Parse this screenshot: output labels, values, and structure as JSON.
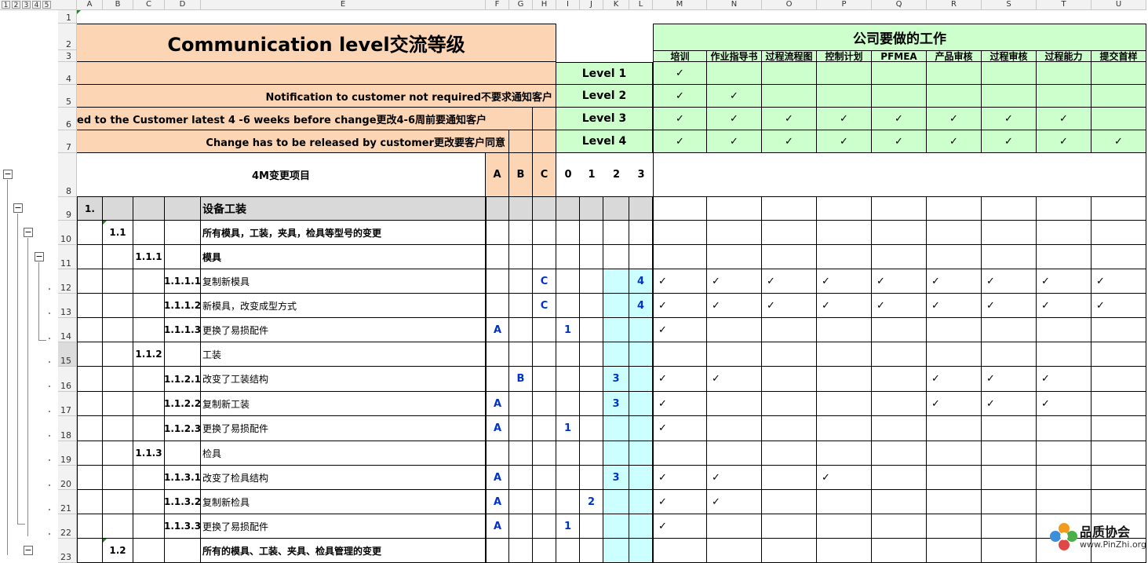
{
  "outline_levels": [
    "1",
    "2",
    "3",
    "4",
    "5"
  ],
  "columns": [
    "A",
    "B",
    "C",
    "D",
    "E",
    "F",
    "G",
    "H",
    "I",
    "J",
    "K",
    "L",
    "M",
    "N",
    "O",
    "P",
    "Q",
    "R",
    "S",
    "T",
    "U"
  ],
  "rows": [
    "1",
    "2",
    "3",
    "4",
    "5",
    "6",
    "7",
    "8",
    "9",
    "10",
    "11",
    "12",
    "13",
    "14",
    "15",
    "16",
    "17",
    "18",
    "19",
    "20",
    "21",
    "22",
    "23"
  ],
  "selected_row": "15",
  "title": "Communication level交流等级",
  "company_header": "公司要做的工作",
  "tasks": [
    "培训",
    "作业指导书",
    "过程流程图",
    "控制计划",
    "PFMEA",
    "产品审核",
    "过程审核",
    "过程能力",
    "提交首样"
  ],
  "notices": {
    "row5": "Notification to customer not required不要求通知客户",
    "row6": "ed to the Customer latest 4 -6 weeks before change更改4-6周前要通知客户",
    "row7": "Change has to be released by customer更改要客户同意"
  },
  "levels": [
    "Level 1",
    "Level 2",
    "Level 3",
    "Level 4"
  ],
  "level_checks": [
    1,
    2,
    8,
    9
  ],
  "check_glyph": "✓",
  "header8": {
    "item": "4M变更项目",
    "a": "A",
    "b": "B",
    "c": "C",
    "n0": "0",
    "n1": "1",
    "n2": "2",
    "n3": "3"
  },
  "table": [
    {
      "row": "9",
      "a": "1.",
      "e": "设备工装",
      "gray": true,
      "e_big": true
    },
    {
      "row": "10",
      "b": "1.1",
      "e": "所有模具，工装，夹具，检具等型号的变更",
      "e_bold": true
    },
    {
      "row": "11",
      "c": "1.1.1",
      "e": "模具",
      "e_bold": true
    },
    {
      "row": "12",
      "d": "1.1.1.1",
      "e": "复制新模具",
      "h": "C",
      "l": "4",
      "checks": 9
    },
    {
      "row": "13",
      "d": "1.1.1.2",
      "e": "新模具，改变成型方式",
      "h": "C",
      "l": "4",
      "checks": 9
    },
    {
      "row": "14",
      "d": "1.1.1.3",
      "e": "更换了易损配件",
      "f": "A",
      "i": "1",
      "checks": 1
    },
    {
      "row": "15",
      "c": "1.1.2",
      "e": "工装"
    },
    {
      "row": "16",
      "d": "1.1.2.1",
      "e": "改变了工装结构",
      "g": "B",
      "k": "3",
      "check_cols": [
        0,
        1,
        5,
        6,
        7
      ]
    },
    {
      "row": "17",
      "d": "1.1.2.2",
      "e": "复制新工装",
      "f": "A",
      "k": "3",
      "check_cols": [
        0,
        5,
        6,
        7
      ]
    },
    {
      "row": "18",
      "d": "1.1.2.3",
      "e": "更换了易损配件",
      "f": "A",
      "i": "1",
      "checks": 1
    },
    {
      "row": "19",
      "c": "1.1.3",
      "e": "检具"
    },
    {
      "row": "20",
      "d": "1.1.3.1",
      "e": "改变了检具结构",
      "f": "A",
      "k": "3",
      "check_cols": [
        0,
        1,
        3
      ]
    },
    {
      "row": "21",
      "d": "1.1.3.2",
      "e": "复制新检具",
      "f": "A",
      "j": "2",
      "check_cols": [
        0,
        1
      ]
    },
    {
      "row": "22",
      "d": "1.1.3.3",
      "e": "更换了易损配件",
      "f": "A",
      "i": "1",
      "checks": 1
    },
    {
      "row": "23",
      "b": "1.2",
      "e": "所有的模具、工装、夹具、检具管理的变更",
      "e_bold": true
    }
  ],
  "watermark": {
    "name": "品质协会",
    "url": "www.PinZhi.org"
  },
  "colors": {
    "orange": "#fcd5b4",
    "green": "#ccffcc",
    "cyan": "#ccffff",
    "blue": "#0033cc"
  }
}
